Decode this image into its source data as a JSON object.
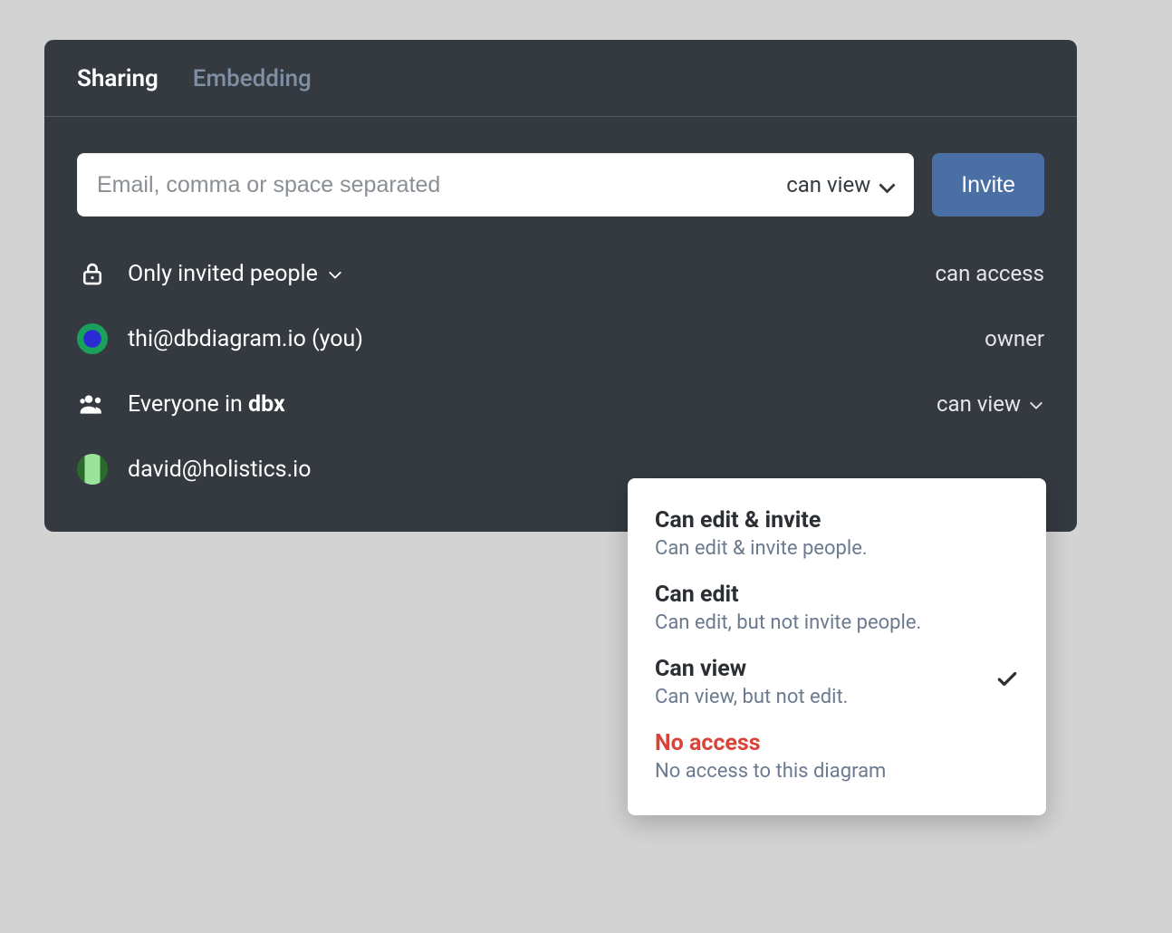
{
  "tabs": {
    "sharing": "Sharing",
    "embedding": "Embedding"
  },
  "invite": {
    "placeholder": "Email, comma or space separated",
    "permission": "can view",
    "button": "Invite"
  },
  "access": {
    "scope_label": "Only invited people",
    "scope_right": "can access"
  },
  "members": [
    {
      "label": "thi@dbdiagram.io (you)",
      "role": "owner"
    },
    {
      "label_prefix": "Everyone in ",
      "label_bold": "dbx",
      "role": "can view",
      "has_chevron": true
    },
    {
      "label": "david@holistics.io",
      "role": ""
    }
  ],
  "dropdown": {
    "options": [
      {
        "title": "Can edit & invite",
        "desc": "Can edit & invite people.",
        "selected": false
      },
      {
        "title": "Can edit",
        "desc": "Can edit, but not invite people.",
        "selected": false
      },
      {
        "title": "Can view",
        "desc": "Can view, but not edit.",
        "selected": true
      },
      {
        "title": "No access",
        "desc": "No access to this diagram",
        "selected": false,
        "danger": true
      }
    ]
  }
}
